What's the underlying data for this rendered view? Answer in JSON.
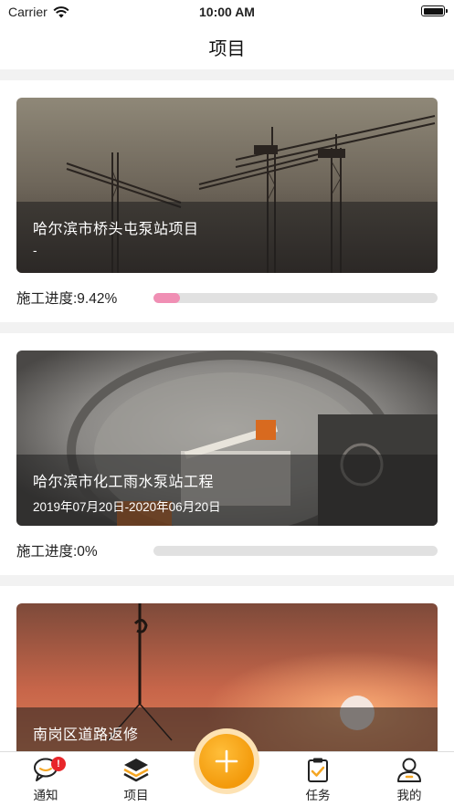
{
  "status_bar": {
    "carrier": "Carrier",
    "time": "10:00 AM"
  },
  "nav": {
    "title": "项目"
  },
  "projects": [
    {
      "title": "哈尔滨市桥头屯泵站项目",
      "dates": "-",
      "progress_label": "施工进度:9.42%",
      "progress": 0.0942,
      "image": "tower-cranes-dusk-photo"
    },
    {
      "title": "哈尔滨市化工雨水泵站工程",
      "dates": "2019年07月20日-2020年06月20日",
      "progress_label": "施工进度:0%",
      "progress": 0,
      "image": "tunnel-construction-photo"
    },
    {
      "title": "南岗区道路返修",
      "dates": "",
      "progress_label": "",
      "progress": null,
      "image": "sunset-crane-hook-photo"
    }
  ],
  "tab_bar": {
    "items": [
      {
        "label": "通知",
        "icon": "chat-bubble-icon",
        "badge": "!"
      },
      {
        "label": "项目",
        "icon": "stack-layers-icon"
      },
      {
        "label": "任务",
        "icon": "clipboard-check-icon"
      },
      {
        "label": "我的",
        "icon": "user-icon"
      }
    ],
    "add_icon": "plus-icon"
  },
  "colors": {
    "progress_fill": "#f08fb4",
    "progress_track": "#e1e1e1",
    "fab": "#f39a0b",
    "badge": "#e8262a",
    "accent_orange": "#f5a623"
  }
}
